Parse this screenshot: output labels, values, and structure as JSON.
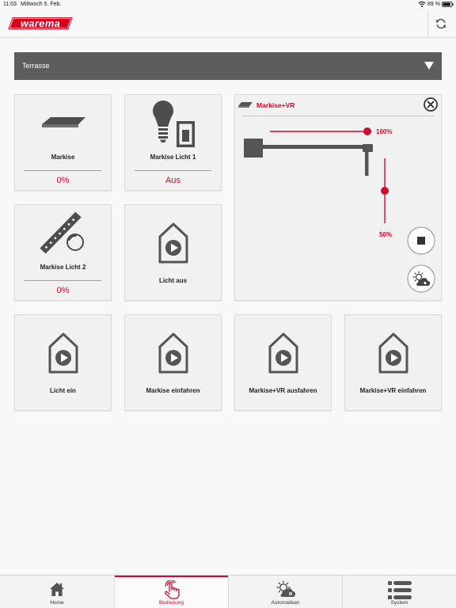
{
  "status_bar": {
    "time": "11:03",
    "date": "Mittwoch 5. Feb.",
    "battery": "89 %",
    "battery_level": 89,
    "icons": [
      "wifi-icon",
      "battery-icon"
    ]
  },
  "header": {
    "logo": "warema",
    "refresh_icon": "refresh-icon"
  },
  "room_select": {
    "selected": "Terrasse",
    "icon": "caret-down-icon"
  },
  "tiles": {
    "markise": {
      "title": "Markise",
      "value": "0%",
      "icon": "awning-icon"
    },
    "markise_licht_1": {
      "title": "Markise Licht 1",
      "value": "Aus",
      "icon": "bulb-switch-icon"
    },
    "markise_licht_2": {
      "title": "Markise Licht 2",
      "value": "0%",
      "icon": "tilted-awning-dial-icon"
    },
    "licht_aus": {
      "title": "Licht aus",
      "icon": "scene-play-icon"
    },
    "licht_ein": {
      "title": "Licht ein",
      "icon": "scene-play-icon"
    },
    "markise_einfahren": {
      "title": "Markise einfahren",
      "icon": "scene-play-icon"
    },
    "markise_vr_ausfahren": {
      "title": "Markise+VR ausfahren",
      "icon": "scene-play-icon"
    },
    "markise_vr_einfahren": {
      "title": "Markise+VR einfahren",
      "icon": "scene-play-icon"
    }
  },
  "control_panel": {
    "title": "Markise+VR",
    "extension": 100,
    "extension_label": "100%",
    "valance": 50,
    "valance_label": "50%",
    "icons": [
      "awning-icon",
      "close-icon",
      "stop-icon",
      "sun-cloud-automation-icon"
    ]
  },
  "tab_bar": {
    "tabs": [
      {
        "label": "Home",
        "icon": "home-icon",
        "active": false
      },
      {
        "label": "Bedienung",
        "icon": "hand-touch-icon",
        "active": true
      },
      {
        "label": "Automatiken",
        "icon": "sun-cloud-icon",
        "active": false
      },
      {
        "label": "System",
        "icon": "list-icon",
        "active": false
      }
    ]
  },
  "colors": {
    "accent": "#cc0b2f",
    "dropdown": "#5d5d5d",
    "icon": "#555555",
    "logo": "#d3001e"
  }
}
